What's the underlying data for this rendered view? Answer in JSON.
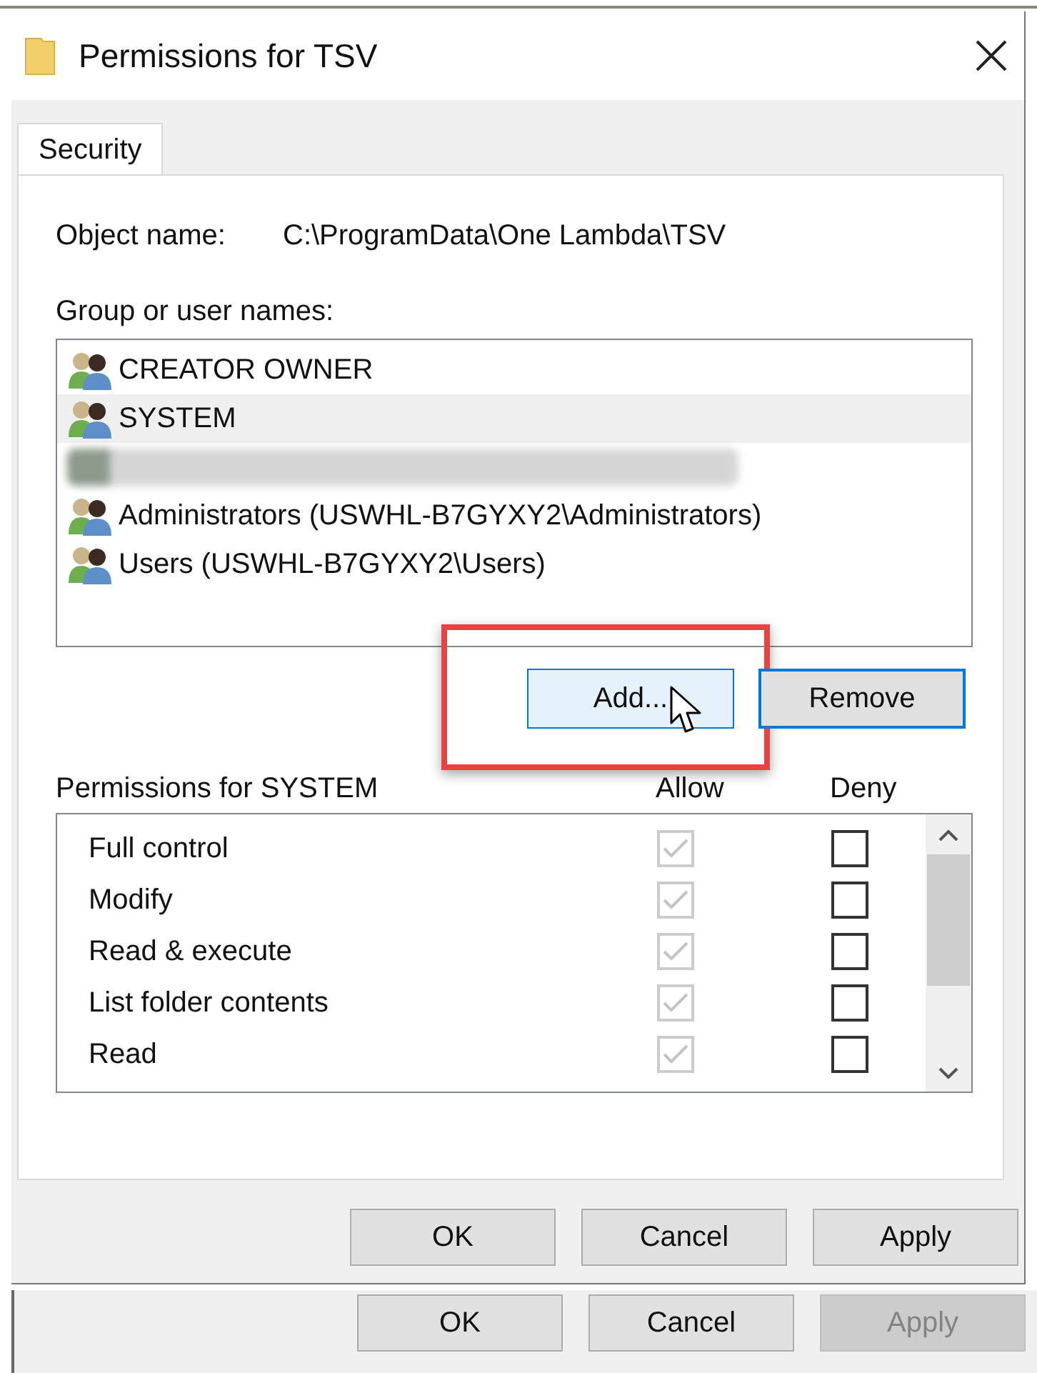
{
  "window": {
    "title": "Permissions for TSV"
  },
  "tabs": [
    {
      "label": "Security",
      "selected": true
    }
  ],
  "object_name": {
    "label": "Object name:",
    "value": "C:\\ProgramData\\One Lambda\\TSV"
  },
  "group_list": {
    "label": "Group or user names:",
    "items": [
      {
        "kind": "group",
        "name": "CREATOR OWNER",
        "selected": false
      },
      {
        "kind": "group",
        "name": "SYSTEM",
        "selected": true
      },
      {
        "kind": "blurred",
        "selected": false
      },
      {
        "kind": "group",
        "name": "Administrators (USWHL-B7GYXY2\\Administrators)",
        "selected": false
      },
      {
        "kind": "group",
        "name": "Users (USWHL-B7GYXY2\\Users)",
        "selected": false
      }
    ]
  },
  "list_buttons": [
    {
      "label": "Add...",
      "hovered": true,
      "default": false,
      "highlighted": true
    },
    {
      "label": "Remove",
      "hovered": false,
      "default": true,
      "highlighted": false
    }
  ],
  "permissions": {
    "label": "Permissions for SYSTEM",
    "allow_label": "Allow",
    "deny_label": "Deny",
    "rows": [
      {
        "name": "Full control",
        "allow": true,
        "allow_disabled": true,
        "deny": false
      },
      {
        "name": "Modify",
        "allow": true,
        "allow_disabled": true,
        "deny": false
      },
      {
        "name": "Read & execute",
        "allow": true,
        "allow_disabled": true,
        "deny": false
      },
      {
        "name": "List folder contents",
        "allow": true,
        "allow_disabled": true,
        "deny": false
      },
      {
        "name": "Read",
        "allow": true,
        "allow_disabled": true,
        "deny": false
      }
    ]
  },
  "dialog_buttons": [
    {
      "label": "OK",
      "disabled": false
    },
    {
      "label": "Cancel",
      "disabled": false
    },
    {
      "label": "Apply",
      "disabled": false
    }
  ],
  "back_window_buttons": [
    {
      "label": "OK",
      "disabled": false
    },
    {
      "label": "Cancel",
      "disabled": false
    },
    {
      "label": "Apply",
      "disabled": true
    }
  ]
}
